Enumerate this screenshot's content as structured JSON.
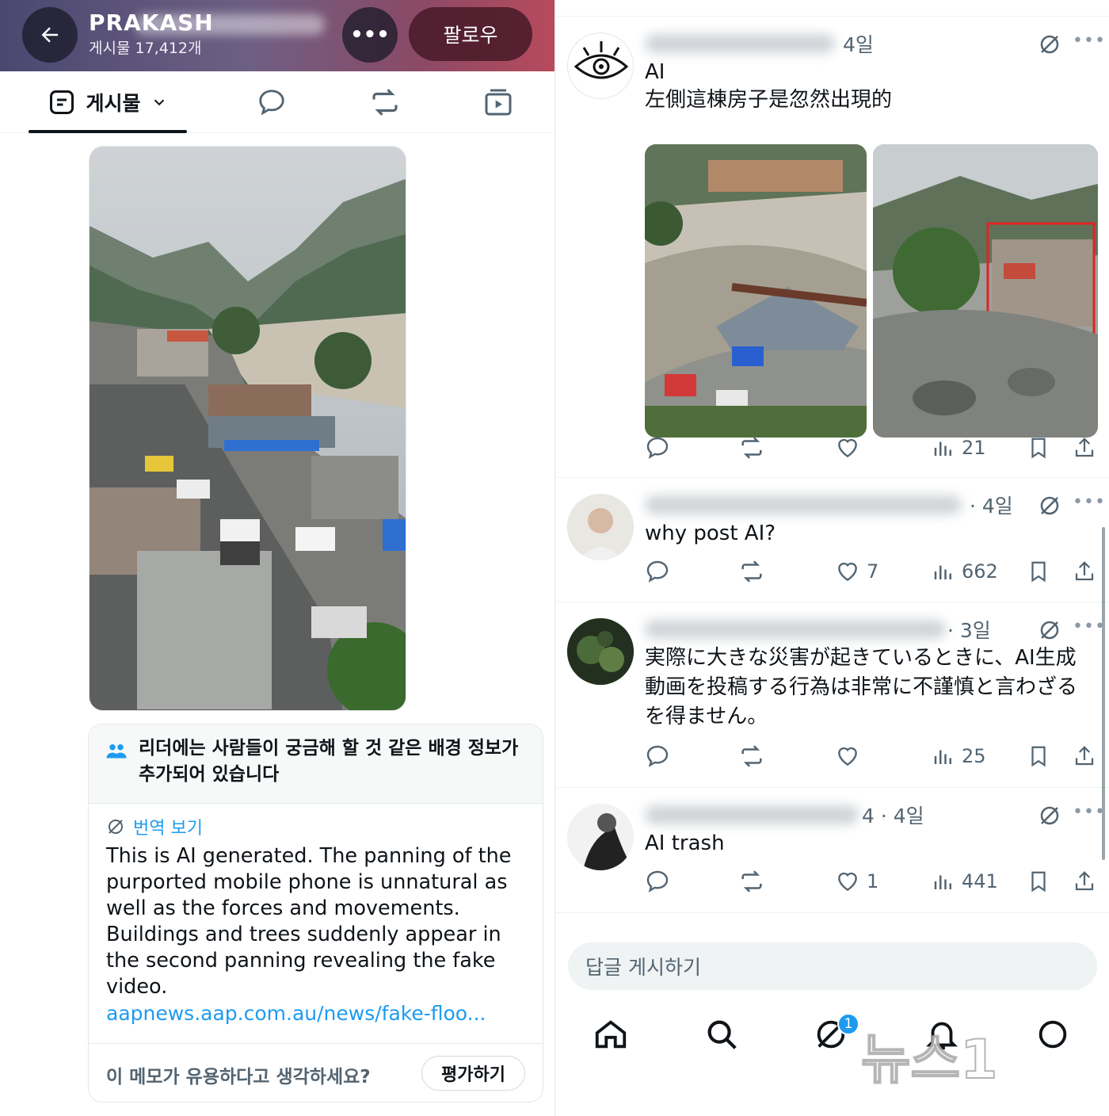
{
  "left": {
    "header": {
      "account_name": "PRAKASH",
      "post_count": "게시물 17,412개",
      "follow_label": "팔로우"
    },
    "tabs": {
      "posts_label": "게시물"
    },
    "note": {
      "title": "리더에는 사람들이 궁금해 할 것 같은 배경 정보가 추가되어 있습니다",
      "translate_label": "번역 보기",
      "body": "This is AI generated. The panning of the purported mobile phone is unnatural as well as the forces and movements. Buildings and trees suddenly appear in the second panning revealing the fake video.",
      "link": "aapnews.aap.com.au/news/fake-floo...",
      "question": "이 메모가 유용하다고 생각하세요?",
      "rate_label": "평가하기"
    }
  },
  "right": {
    "posts": [
      {
        "time": "4일",
        "text_line1": "AI",
        "text_line2": "左側這棟房子是忽然出現的",
        "likes": "",
        "views": "21"
      },
      {
        "time": "· 4일",
        "text": "why post AI?",
        "likes": "7",
        "views": "662"
      },
      {
        "time": "· 3일",
        "text": "実際に大きな災害が起きているときに、AI生成動画を投稿する行為は非常に不謹慎と言わざるを得ません。",
        "likes": "",
        "views": "25"
      },
      {
        "time": "4 · 4일",
        "text": "AI trash",
        "likes": "1",
        "views": "441"
      }
    ],
    "reply_placeholder": "답글 게시하기",
    "notification_badge": "1",
    "watermark_text": "뉴스1"
  },
  "colors": {
    "accent": "#1d9bf0",
    "text": "#0f1419",
    "muted": "#536471"
  },
  "icons": [
    "back-arrow-icon",
    "more-icon",
    "posts-icon",
    "chevron-down-icon",
    "reply-icon",
    "repost-icon",
    "video-icon",
    "community-note-icon",
    "grok-icon",
    "like-icon",
    "views-icon",
    "bookmark-icon",
    "share-icon",
    "home-icon",
    "search-icon",
    "notification-bell-icon"
  ]
}
